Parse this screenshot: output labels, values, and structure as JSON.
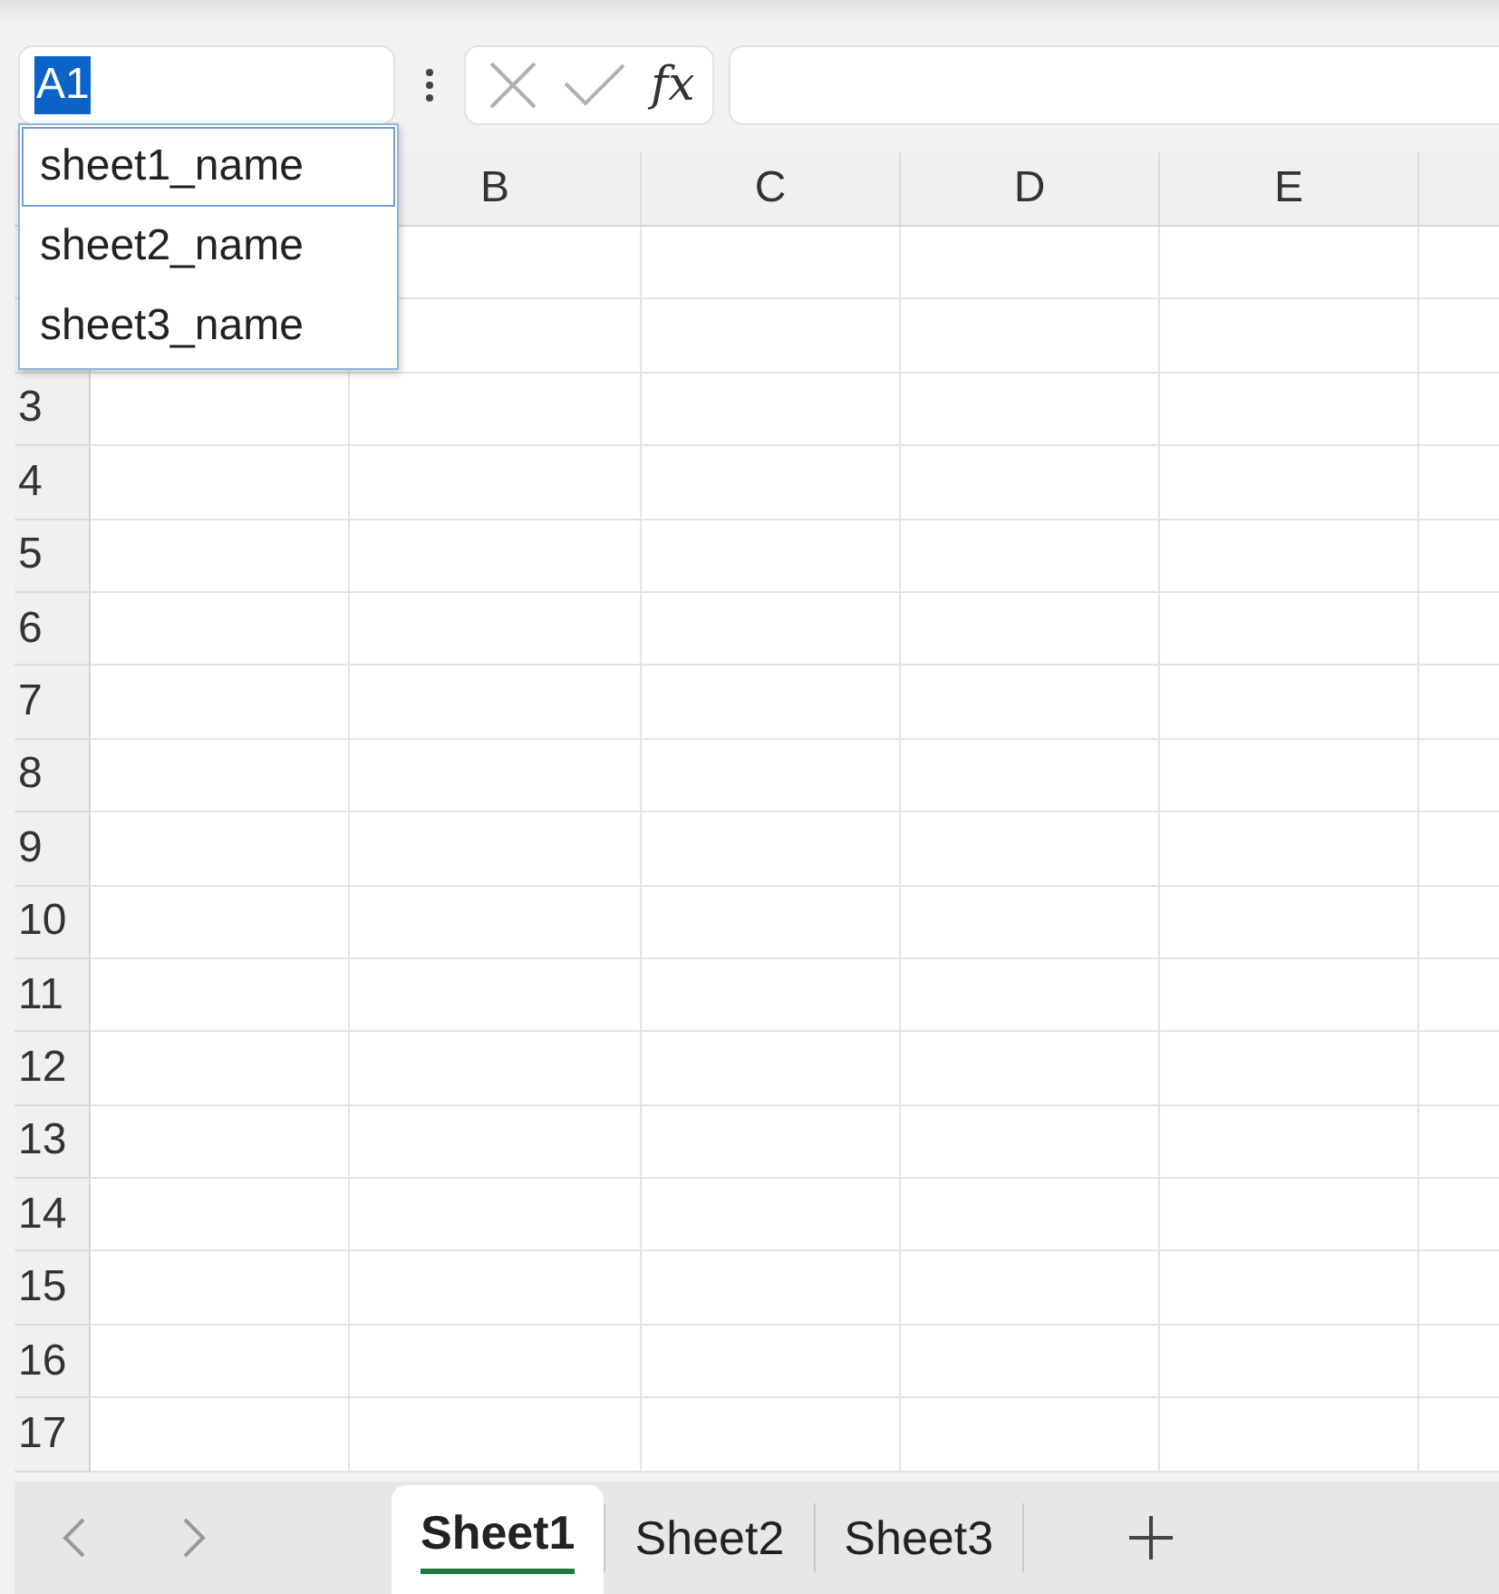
{
  "name_box": {
    "value": "A1"
  },
  "name_menu": [
    {
      "label": "sheet1_name",
      "selected": true
    },
    {
      "label": "sheet2_name",
      "selected": false
    },
    {
      "label": "sheet3_name",
      "selected": false
    }
  ],
  "formula_bar": {
    "function_label": "fx"
  },
  "columns": [
    "B",
    "C",
    "D",
    "E"
  ],
  "rows": [
    "3",
    "4",
    "5",
    "6",
    "7",
    "8",
    "9",
    "10",
    "11",
    "12",
    "13",
    "14",
    "15",
    "16",
    "17"
  ],
  "sheet_tabs": [
    {
      "label": "Sheet1",
      "selected": true
    },
    {
      "label": "Sheet2",
      "selected": false
    },
    {
      "label": "Sheet3",
      "selected": false
    }
  ]
}
